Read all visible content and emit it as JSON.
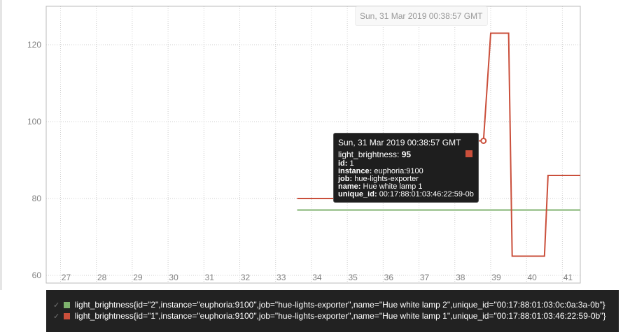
{
  "hover_date": "Sun, 31 Mar 2019 00:38:57 GMT",
  "tooltip": {
    "date": "Sun, 31 Mar 2019 00:38:57 GMT",
    "metric_label": "light_brightness:",
    "metric_value": "95",
    "swatch_color": "#ca4f3b",
    "labels": [
      {
        "key": "id",
        "value": "1"
      },
      {
        "key": "instance",
        "value": "euphoria:9100"
      },
      {
        "key": "job",
        "value": "hue-lights-exporter"
      },
      {
        "key": "name",
        "value": "Hue white lamp 1"
      },
      {
        "key": "unique_id",
        "value": "00:17:88:01:03:46:22:59-0b"
      }
    ]
  },
  "legend": {
    "items": [
      {
        "check": "✓",
        "color": "#7eb26d",
        "label": "light_brightness{id=\"2\",instance=\"euphoria:9100\",job=\"hue-lights-exporter\",name=\"Hue white lamp 2\",unique_id=\"00:17:88:01:03:0c:0a:3a-0b\"}"
      },
      {
        "check": "✓",
        "color": "#ca4f3b",
        "label": "light_brightness{id=\"1\",instance=\"euphoria:9100\",job=\"hue-lights-exporter\",name=\"Hue white lamp 1\",unique_id=\"00:17:88:01:03:46:22:59-0b\"}"
      }
    ]
  },
  "chart_data": {
    "type": "line",
    "x_ticks": [
      "27",
      "28",
      "29",
      "30",
      "31",
      "32",
      "33",
      "34",
      "35",
      "36",
      "37",
      "38",
      "39",
      "40",
      "41"
    ],
    "y_ticks": [
      "60",
      "80",
      "100",
      "120"
    ],
    "xlim": [
      26.6,
      41.5
    ],
    "ylim": [
      58,
      130
    ],
    "grid": true,
    "series": [
      {
        "color": "#7eb26d",
        "points": [
          [
            33.6,
            77
          ],
          [
            41.5,
            77
          ]
        ]
      },
      {
        "color": "#ca4f3b",
        "points": [
          [
            33.6,
            80
          ],
          [
            38.2,
            80
          ],
          [
            38.4,
            95
          ],
          [
            38.8,
            95
          ],
          [
            39.0,
            123
          ],
          [
            39.5,
            123
          ],
          [
            39.6,
            65
          ],
          [
            40.5,
            65
          ],
          [
            40.6,
            86
          ],
          [
            41.5,
            86
          ]
        ]
      }
    ],
    "highlight_point": {
      "x": 38.8,
      "y": 95
    }
  }
}
